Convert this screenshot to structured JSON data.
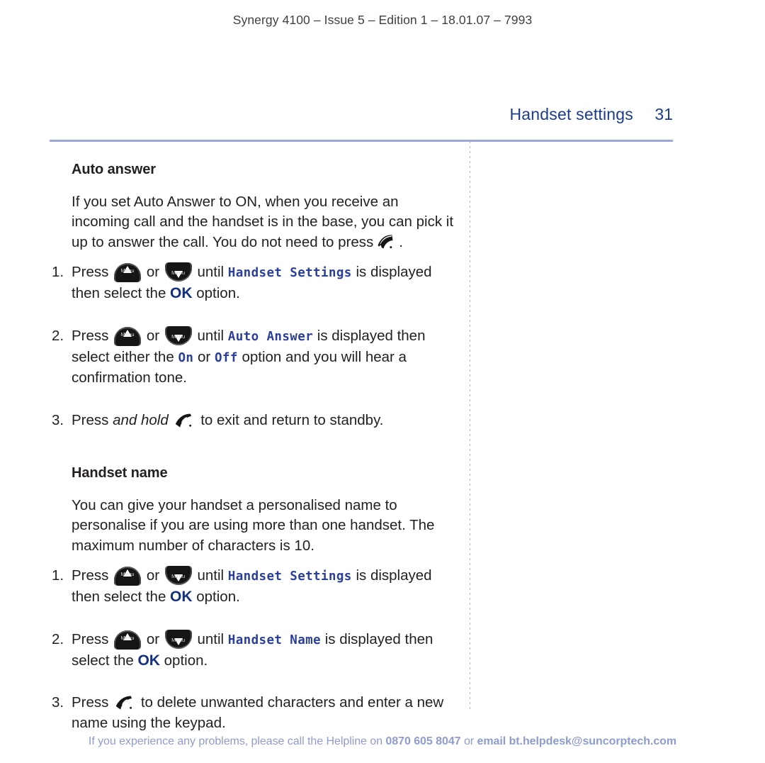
{
  "running_head": "Synergy 4100 – Issue 5 – Edition 1 – 18.01.07 – 7993",
  "header": {
    "section_title": "Handset settings",
    "page_number": "31",
    "accent_color": "#1b3c8c",
    "rule_color": "#9aa8d8"
  },
  "sections": [
    {
      "heading": "Auto answer",
      "paragraph_1": "If you set Auto Answer to ON, when you receive an incoming call and the handset is in the base, you can pick it up to answer the call. You do not need to",
      "paragraph_1_tail": "press",
      "paragraph_1_end": ".",
      "steps": [
        {
          "num": "1.",
          "t1": "Press",
          "t2": "or",
          "t3": "until",
          "lcd": "Handset Settings",
          "t4": "is displayed then select the",
          "ok": "OK",
          "t5": "option."
        },
        {
          "num": "2.",
          "t1": "Press",
          "t2": "or",
          "t3": "until",
          "lcd": "Auto Answer",
          "t4": "is displayed then select either the",
          "lcd_on": "On",
          "t5": "or",
          "lcd_off": "Off",
          "t6": "option and you will hear a confirmation tone."
        },
        {
          "num": "3.",
          "t1": "Press",
          "emph": "and hold",
          "t2": "to exit and return to standby."
        }
      ]
    },
    {
      "heading": "Handset name",
      "paragraph_1": "You can give your handset a personalised name to personalise if you are using more than one handset. The maximum number of characters is 10.",
      "steps": [
        {
          "num": "1.",
          "t1": "Press",
          "t2": "or",
          "t3": "until",
          "lcd": "Handset Settings",
          "t4": "is displayed then select the",
          "ok": "OK",
          "t5": "option."
        },
        {
          "num": "2.",
          "t1": "Press",
          "t2": "or",
          "t3": "until",
          "lcd": "Handset Name",
          "t4": "is displayed then select the",
          "ok": "OK",
          "t5": "option."
        },
        {
          "num": "3.",
          "t1": "Press",
          "t2": "to delete unwanted characters and enter a new name using the keypad."
        }
      ]
    }
  ],
  "keys": {
    "up_label": "Menu",
    "down_label": "Menu"
  },
  "footer": {
    "t1": "If you experience any problems, please call the Helpline on",
    "phone": "0870 605 8047",
    "t2": "or",
    "email": "email bt.helpdesk@suncorptech.com",
    "color": "#8e9ccd"
  }
}
